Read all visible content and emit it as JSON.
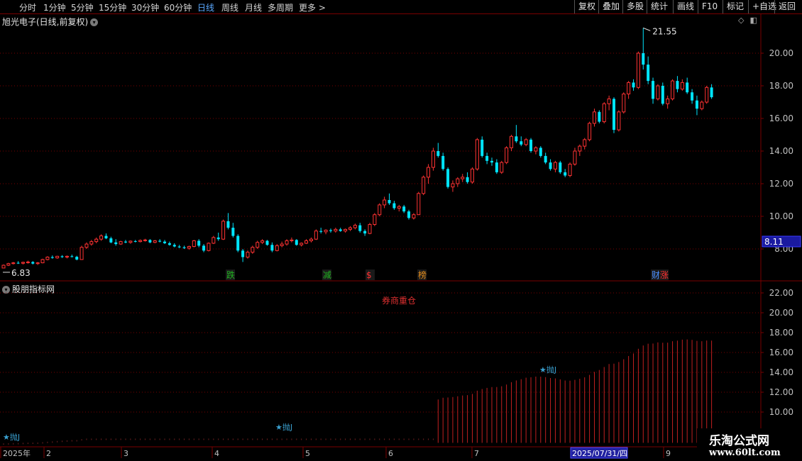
{
  "toolbar": {
    "periods": [
      "分时",
      "1分钟",
      "5分钟",
      "15分钟",
      "30分钟",
      "60分钟",
      "日线",
      "周线",
      "月线",
      "多周期",
      "更多 >"
    ],
    "active_period": "日线",
    "right_buttons": [
      "复权",
      "叠加",
      "多股",
      "统计",
      "画线",
      "F10",
      "标记",
      "+自选",
      "返回"
    ]
  },
  "main_chart": {
    "title": "旭光电子(日线,前复权)",
    "y_ticks": [
      "20.00",
      "18.00",
      "16.00",
      "14.00",
      "12.00",
      "10.00",
      "8.00"
    ],
    "high_label": "21.55",
    "low_label": "6.83",
    "current_price": "8.11",
    "event_markers": [
      {
        "text": "跌",
        "color": "#1fb31f"
      },
      {
        "text": "减",
        "color": "#1fb31f"
      },
      {
        "text": "$",
        "color": "#ff3030"
      },
      {
        "text": "榜",
        "color": "#e08a1a"
      },
      {
        "text": "财",
        "color": "#4a90ff"
      },
      {
        "text": "涨",
        "color": "#ff3030"
      }
    ]
  },
  "indicator": {
    "title": "股朋指标网",
    "note": "券商重仓",
    "y_ticks": [
      "22.00",
      "20.00",
      "18.00",
      "16.00",
      "14.00",
      "12.00",
      "10.00"
    ],
    "signal_labels": [
      "★抛J",
      "★抛J",
      "★抛J"
    ]
  },
  "x_axis": {
    "labels": [
      "2025年",
      "2",
      "3",
      "4",
      "5",
      "6",
      "7",
      "2025/07/31/四",
      "9"
    ]
  },
  "watermark": {
    "line1": "乐淘公式网",
    "line2": "www.60lt.com"
  },
  "colors": {
    "up": "#ff3232",
    "down": "#00e5ff",
    "grid": "#7a0000",
    "axis_text": "#c0c0c0",
    "active_period": "#5aa8ff"
  },
  "chart_data": {
    "type": "candlestick",
    "ylim": [
      6.0,
      22.5
    ],
    "ohlc": [
      [
        6.83,
        7.05,
        6.83,
        7.0
      ],
      [
        7.0,
        7.15,
        6.95,
        7.1
      ],
      [
        7.1,
        7.2,
        7.05,
        7.15
      ],
      [
        7.15,
        7.25,
        7.08,
        7.12
      ],
      [
        7.12,
        7.22,
        7.05,
        7.18
      ],
      [
        7.18,
        7.28,
        7.1,
        7.2
      ],
      [
        7.2,
        7.25,
        7.05,
        7.1
      ],
      [
        7.1,
        7.2,
        7.02,
        7.15
      ],
      [
        7.15,
        7.4,
        7.12,
        7.35
      ],
      [
        7.35,
        7.55,
        7.3,
        7.5
      ],
      [
        7.5,
        7.6,
        7.4,
        7.45
      ],
      [
        7.45,
        7.58,
        7.4,
        7.55
      ],
      [
        7.55,
        7.62,
        7.45,
        7.5
      ],
      [
        7.5,
        7.6,
        7.42,
        7.55
      ],
      [
        7.55,
        7.65,
        7.48,
        7.52
      ],
      [
        7.52,
        7.58,
        7.3,
        7.35
      ],
      [
        7.35,
        8.2,
        7.35,
        8.1
      ],
      [
        8.1,
        8.4,
        8.0,
        8.3
      ],
      [
        8.3,
        8.55,
        8.2,
        8.45
      ],
      [
        8.45,
        8.7,
        8.35,
        8.6
      ],
      [
        8.6,
        8.9,
        8.5,
        8.8
      ],
      [
        8.8,
        8.95,
        8.6,
        8.65
      ],
      [
        8.65,
        8.75,
        8.35,
        8.4
      ],
      [
        8.4,
        8.6,
        8.2,
        8.3
      ],
      [
        8.3,
        8.5,
        8.25,
        8.45
      ],
      [
        8.45,
        8.55,
        8.35,
        8.4
      ],
      [
        8.4,
        8.52,
        8.32,
        8.48
      ],
      [
        8.48,
        8.55,
        8.4,
        8.45
      ],
      [
        8.45,
        8.58,
        8.4,
        8.52
      ],
      [
        8.52,
        8.62,
        8.45,
        8.55
      ],
      [
        8.55,
        8.6,
        8.35,
        8.4
      ],
      [
        8.4,
        8.55,
        8.35,
        8.5
      ],
      [
        8.5,
        8.6,
        8.4,
        8.45
      ],
      [
        8.45,
        8.55,
        8.3,
        8.35
      ],
      [
        8.35,
        8.45,
        8.2,
        8.25
      ],
      [
        8.25,
        8.35,
        8.1,
        8.15
      ],
      [
        8.15,
        8.25,
        8.05,
        8.1
      ],
      [
        8.1,
        8.2,
        8.0,
        8.05
      ],
      [
        8.05,
        8.2,
        7.95,
        8.15
      ],
      [
        8.15,
        8.55,
        8.1,
        8.5
      ],
      [
        8.5,
        8.6,
        8.1,
        8.2
      ],
      [
        8.2,
        8.3,
        7.8,
        7.9
      ],
      [
        7.9,
        8.4,
        7.85,
        8.35
      ],
      [
        8.35,
        8.8,
        8.3,
        8.7
      ],
      [
        8.7,
        9.0,
        8.5,
        8.6
      ],
      [
        8.6,
        9.8,
        8.55,
        9.7
      ],
      [
        9.7,
        10.2,
        9.2,
        9.3
      ],
      [
        9.3,
        9.6,
        8.7,
        8.8
      ],
      [
        8.8,
        8.9,
        7.8,
        7.9
      ],
      [
        7.9,
        8.0,
        7.2,
        7.5
      ],
      [
        7.5,
        7.9,
        7.4,
        7.8
      ],
      [
        7.8,
        8.2,
        7.7,
        8.1
      ],
      [
        8.1,
        8.5,
        8.0,
        8.4
      ],
      [
        8.4,
        8.6,
        8.3,
        8.5
      ],
      [
        8.5,
        8.55,
        8.2,
        8.25
      ],
      [
        8.25,
        8.4,
        7.8,
        7.9
      ],
      [
        7.9,
        8.3,
        7.85,
        8.2
      ],
      [
        8.2,
        8.45,
        8.1,
        8.3
      ],
      [
        8.3,
        8.6,
        8.2,
        8.5
      ],
      [
        8.5,
        8.7,
        8.4,
        8.55
      ],
      [
        8.55,
        8.6,
        8.2,
        8.25
      ],
      [
        8.25,
        8.4,
        8.15,
        8.35
      ],
      [
        8.35,
        8.6,
        8.3,
        8.5
      ],
      [
        8.5,
        8.7,
        8.4,
        8.6
      ],
      [
        8.6,
        9.2,
        8.55,
        9.1
      ],
      [
        9.1,
        9.3,
        8.95,
        9.05
      ],
      [
        9.05,
        9.2,
        8.9,
        9.15
      ],
      [
        9.15,
        9.25,
        9.0,
        9.1
      ],
      [
        9.1,
        9.3,
        9.0,
        9.2
      ],
      [
        9.2,
        9.3,
        9.05,
        9.1
      ],
      [
        9.1,
        9.25,
        9.0,
        9.2
      ],
      [
        9.2,
        9.4,
        9.1,
        9.3
      ],
      [
        9.3,
        9.55,
        9.2,
        9.45
      ],
      [
        9.45,
        9.6,
        9.0,
        9.1
      ],
      [
        9.1,
        9.2,
        8.8,
        8.95
      ],
      [
        8.95,
        9.6,
        8.9,
        9.5
      ],
      [
        9.5,
        10.2,
        9.4,
        10.1
      ],
      [
        10.1,
        10.8,
        10.0,
        10.7
      ],
      [
        10.7,
        11.2,
        10.5,
        11.0
      ],
      [
        11.0,
        11.4,
        10.7,
        10.8
      ],
      [
        10.8,
        10.95,
        10.4,
        10.5
      ],
      [
        10.5,
        10.7,
        10.3,
        10.6
      ],
      [
        10.6,
        10.7,
        10.2,
        10.3
      ],
      [
        10.3,
        10.4,
        9.8,
        9.9
      ],
      [
        9.9,
        10.2,
        9.8,
        10.1
      ],
      [
        10.1,
        11.5,
        10.1,
        11.4
      ],
      [
        11.4,
        12.5,
        11.3,
        12.4
      ],
      [
        12.4,
        13.2,
        12.0,
        13.0
      ],
      [
        13.0,
        14.2,
        12.8,
        14.0
      ],
      [
        14.0,
        14.5,
        13.6,
        13.7
      ],
      [
        13.7,
        13.9,
        12.8,
        12.9
      ],
      [
        12.9,
        13.0,
        11.7,
        11.8
      ],
      [
        11.8,
        12.2,
        11.5,
        12.0
      ],
      [
        12.0,
        12.4,
        11.8,
        12.3
      ],
      [
        12.3,
        12.6,
        12.1,
        12.4
      ],
      [
        12.4,
        12.7,
        12.0,
        12.1
      ],
      [
        12.1,
        13.0,
        12.0,
        12.9
      ],
      [
        12.9,
        14.8,
        12.8,
        14.7
      ],
      [
        14.7,
        14.9,
        13.6,
        13.7
      ],
      [
        13.7,
        13.9,
        13.2,
        13.4
      ],
      [
        13.4,
        13.6,
        13.1,
        13.3
      ],
      [
        13.3,
        13.5,
        12.6,
        12.7
      ],
      [
        12.7,
        13.4,
        12.6,
        13.3
      ],
      [
        13.3,
        14.3,
        13.2,
        14.2
      ],
      [
        14.2,
        15.0,
        14.0,
        14.9
      ],
      [
        14.9,
        15.6,
        14.5,
        14.6
      ],
      [
        14.6,
        14.9,
        14.3,
        14.4
      ],
      [
        14.4,
        14.8,
        14.3,
        14.7
      ],
      [
        14.7,
        14.8,
        13.9,
        14.0
      ],
      [
        14.0,
        14.3,
        13.8,
        14.2
      ],
      [
        14.2,
        14.3,
        13.6,
        13.7
      ],
      [
        13.7,
        13.9,
        13.2,
        13.3
      ],
      [
        13.3,
        13.5,
        12.8,
        12.9
      ],
      [
        12.9,
        13.4,
        12.7,
        13.3
      ],
      [
        13.3,
        13.4,
        12.6,
        12.7
      ],
      [
        12.7,
        12.9,
        12.4,
        12.5
      ],
      [
        12.5,
        13.3,
        12.4,
        13.2
      ],
      [
        13.2,
        14.2,
        13.1,
        14.0
      ],
      [
        14.0,
        14.4,
        13.7,
        14.3
      ],
      [
        14.3,
        14.8,
        14.1,
        14.7
      ],
      [
        14.7,
        15.8,
        14.6,
        15.7
      ],
      [
        15.7,
        16.6,
        15.5,
        16.4
      ],
      [
        16.4,
        16.5,
        15.7,
        15.8
      ],
      [
        15.8,
        17.0,
        15.7,
        16.9
      ],
      [
        16.9,
        17.4,
        16.5,
        17.2
      ],
      [
        17.2,
        17.3,
        15.1,
        15.3
      ],
      [
        15.3,
        16.5,
        15.2,
        16.4
      ],
      [
        16.4,
        17.6,
        16.3,
        17.5
      ],
      [
        17.5,
        18.3,
        17.2,
        18.2
      ],
      [
        18.2,
        18.4,
        17.7,
        17.9
      ],
      [
        17.9,
        20.1,
        17.8,
        20.0
      ],
      [
        20.0,
        21.55,
        19.0,
        19.3
      ],
      [
        19.3,
        19.8,
        18.1,
        18.3
      ],
      [
        18.3,
        18.5,
        16.9,
        17.2
      ],
      [
        17.2,
        18.1,
        17.1,
        18.0
      ],
      [
        18.0,
        18.2,
        16.8,
        16.9
      ],
      [
        16.9,
        17.4,
        16.6,
        17.2
      ],
      [
        17.2,
        18.4,
        17.1,
        18.3
      ],
      [
        18.3,
        18.6,
        17.6,
        17.8
      ],
      [
        17.8,
        18.4,
        17.7,
        18.2
      ],
      [
        18.2,
        18.5,
        17.5,
        17.6
      ],
      [
        17.6,
        17.8,
        16.9,
        17.1
      ],
      [
        17.1,
        17.4,
        16.2,
        16.6
      ],
      [
        16.6,
        17.1,
        16.5,
        17.0
      ],
      [
        17.0,
        18.0,
        16.9,
        17.9
      ],
      [
        17.9,
        18.1,
        17.2,
        17.3
      ]
    ]
  }
}
